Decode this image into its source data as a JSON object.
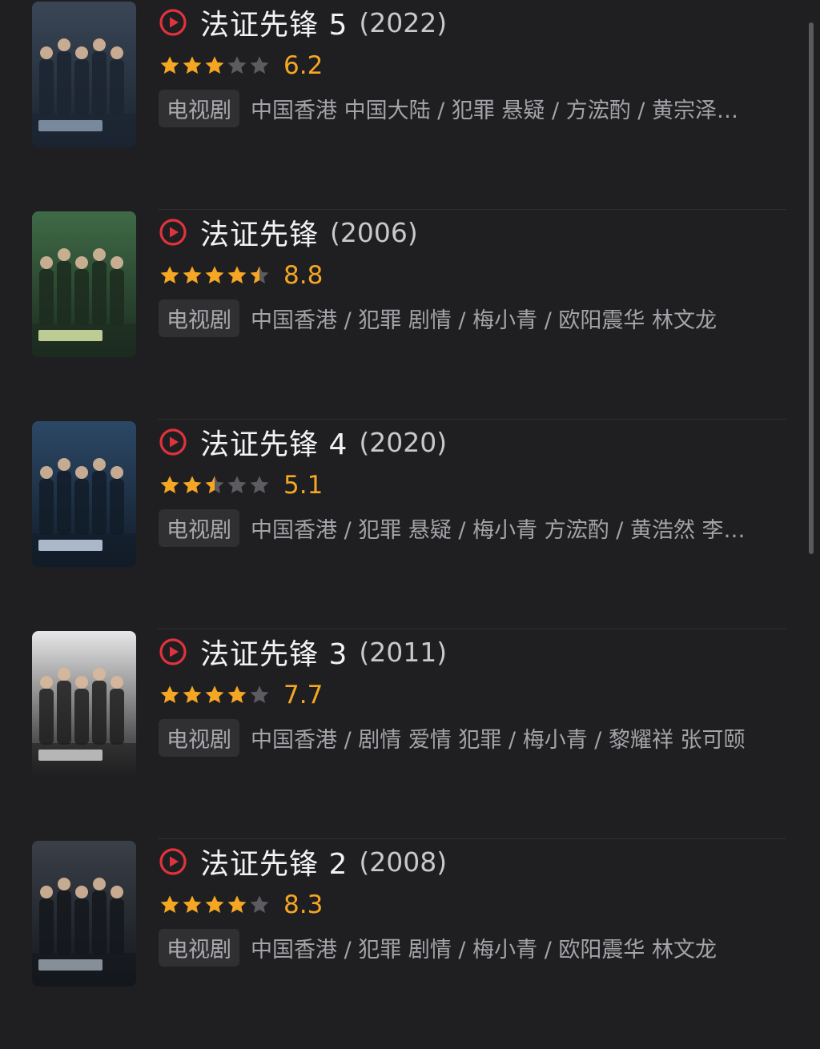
{
  "colors": {
    "background": "#1f1f21",
    "accent_red": "#e0333d",
    "star_filled": "#f5a623",
    "star_empty": "#5c5c60"
  },
  "items": [
    {
      "title": "法证先锋 5",
      "year": "(2022)",
      "rating": 6.2,
      "stars": 3,
      "score": "6.2",
      "tag": "电视剧",
      "meta": "中国香港 中国大陆 / 犯罪 悬疑 / 方浤酌 / 黄宗泽…",
      "poster_icon": "poster-image"
    },
    {
      "title": "法证先锋",
      "year": "(2006)",
      "rating": 8.8,
      "stars": 4.5,
      "score": "8.8",
      "tag": "电视剧",
      "meta": "中国香港 / 犯罪 剧情 / 梅小青 / 欧阳震华 林文龙",
      "poster_icon": "poster-image"
    },
    {
      "title": "法证先锋 4",
      "year": "(2020)",
      "rating": 5.1,
      "stars": 2.5,
      "score": "5.1",
      "tag": "电视剧",
      "meta": "中国香港 / 犯罪 悬疑 / 梅小青 方浤酌 / 黄浩然 李…",
      "poster_icon": "poster-image"
    },
    {
      "title": "法证先锋 3",
      "year": "(2011)",
      "rating": 7.7,
      "stars": 4,
      "score": "7.7",
      "tag": "电视剧",
      "meta": "中国香港 / 剧情 爱情 犯罪 / 梅小青 / 黎耀祥 张可颐",
      "poster_icon": "poster-image"
    },
    {
      "title": "法证先锋 2",
      "year": "(2008)",
      "rating": 8.3,
      "stars": 4,
      "score": "8.3",
      "tag": "电视剧",
      "meta": "中国香港 / 犯罪 剧情 / 梅小青 / 欧阳震华 林文龙",
      "poster_icon": "poster-image"
    }
  ]
}
